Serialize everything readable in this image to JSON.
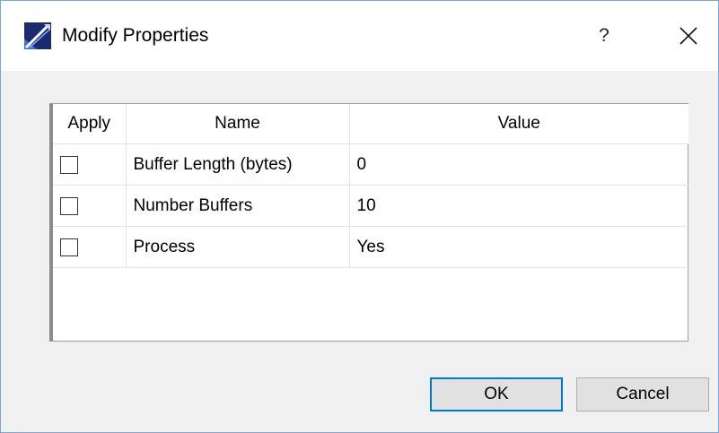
{
  "window": {
    "title": "Modify Properties",
    "help_label": "?",
    "close_icon": "close-icon",
    "app_icon": "app-icon"
  },
  "table": {
    "headers": [
      "Apply",
      "Name",
      "Value"
    ],
    "rows": [
      {
        "apply": false,
        "name": "Buffer Length (bytes)",
        "value": "0"
      },
      {
        "apply": false,
        "name": "Number Buffers",
        "value": "10"
      },
      {
        "apply": false,
        "name": "Process",
        "value": "Yes"
      }
    ]
  },
  "buttons": {
    "ok_label": "OK",
    "cancel_label": "Cancel"
  },
  "colors": {
    "default_button_border": "#0078d7",
    "window_border": "#7aa7d6"
  }
}
